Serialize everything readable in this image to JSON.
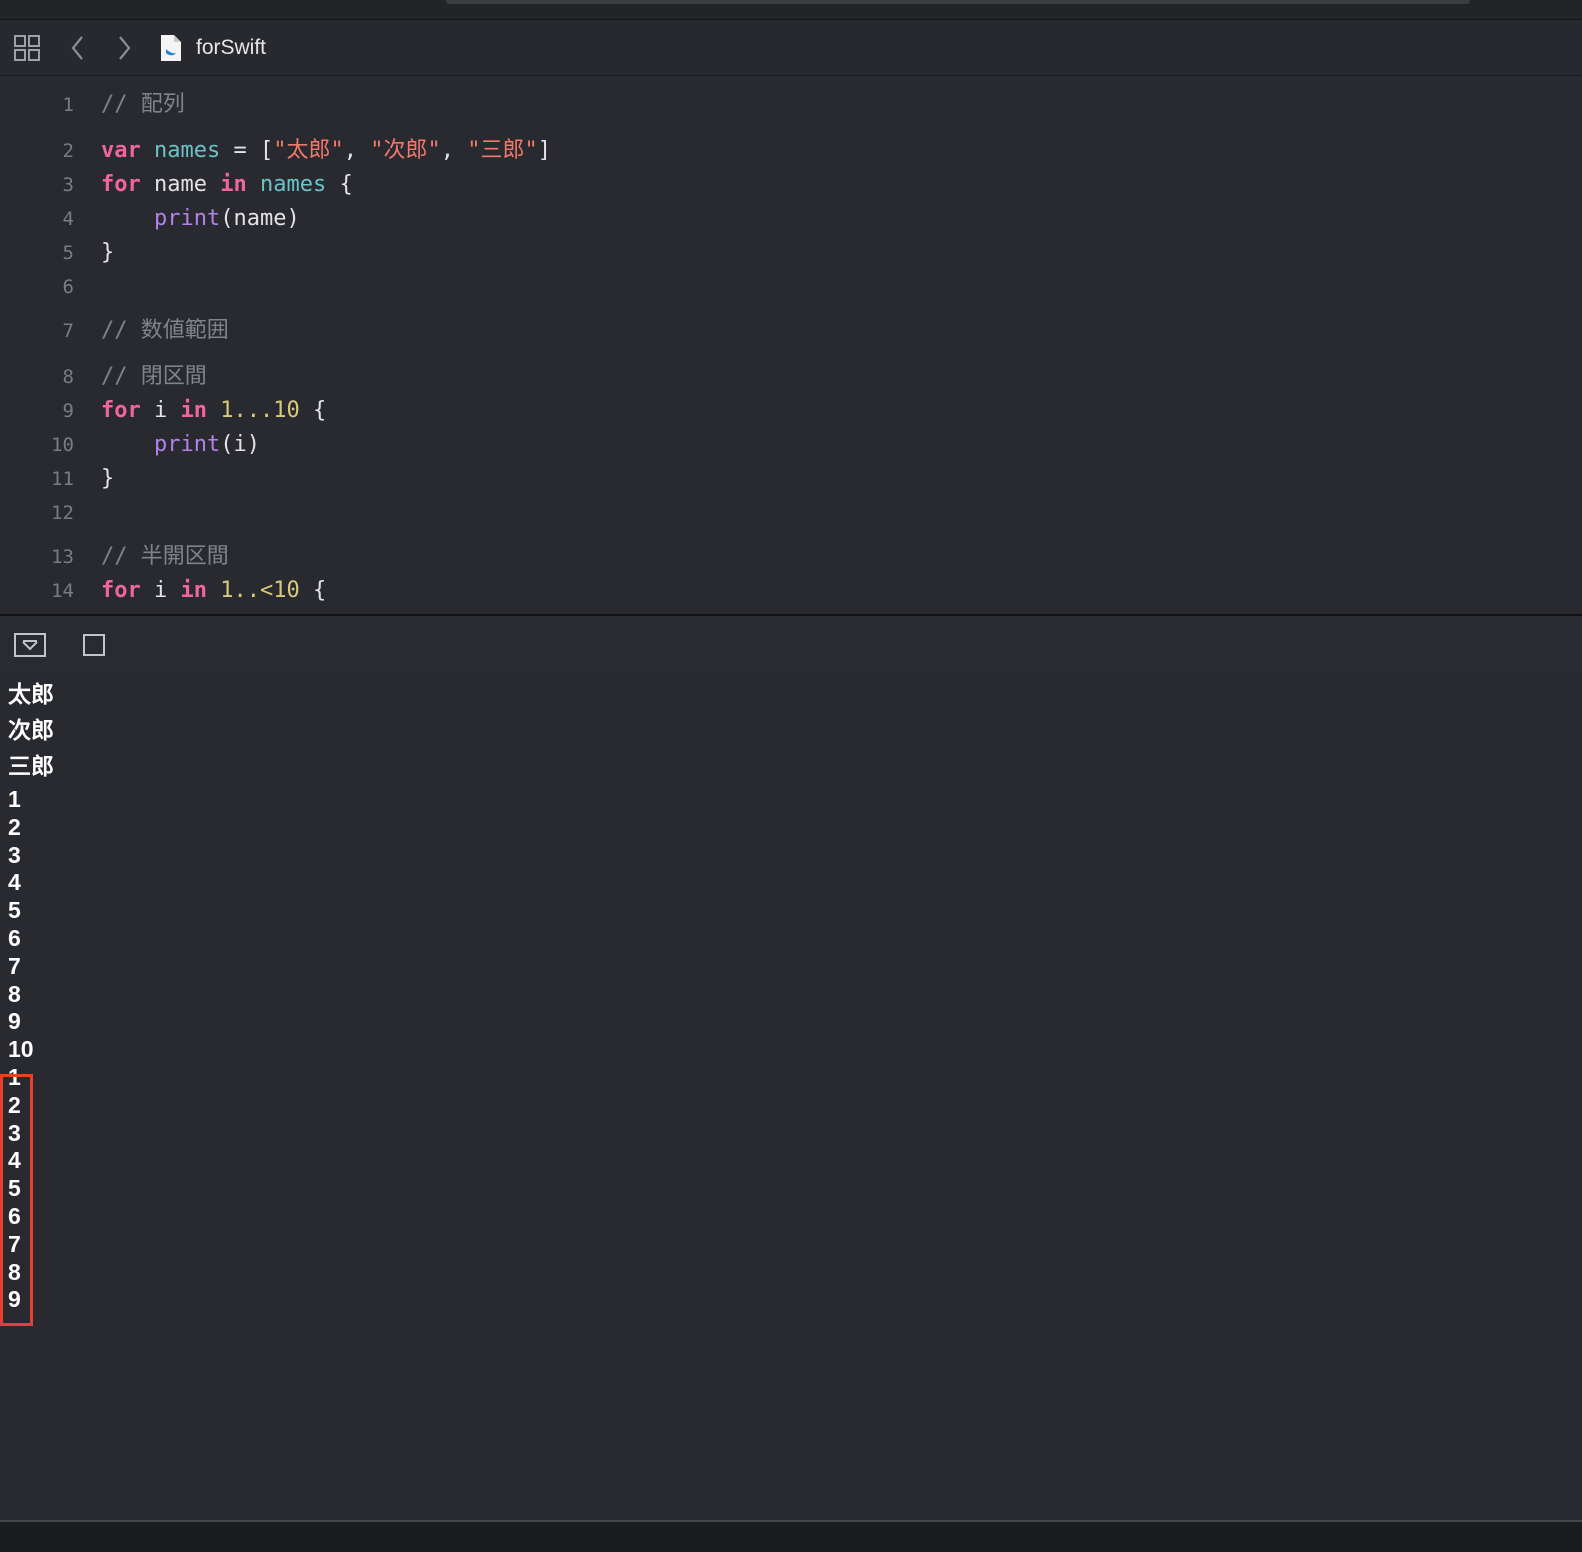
{
  "jumpbar": {
    "file_title": "forSwift",
    "icons": [
      "grid-icon",
      "back-arrow-icon",
      "forward-arrow-icon",
      "swift-file-icon"
    ]
  },
  "editor": {
    "lines": [
      {
        "n": "1",
        "tokens": [
          [
            "cm",
            "// 配列"
          ]
        ]
      },
      {
        "n": "2",
        "tokens": [
          [
            "kw",
            "var"
          ],
          [
            "plain",
            " "
          ],
          [
            "ident",
            "names"
          ],
          [
            "plain",
            " = ["
          ],
          [
            "str",
            "\"太郎\""
          ],
          [
            "plain",
            ", "
          ],
          [
            "str",
            "\"次郎\""
          ],
          [
            "plain",
            ", "
          ],
          [
            "str",
            "\"三郎\""
          ],
          [
            "plain",
            "]"
          ]
        ]
      },
      {
        "n": "3",
        "tokens": [
          [
            "kw",
            "for"
          ],
          [
            "plain",
            " name "
          ],
          [
            "kw",
            "in"
          ],
          [
            "plain",
            " "
          ],
          [
            "ident",
            "names"
          ],
          [
            "plain",
            " {"
          ]
        ]
      },
      {
        "n": "4",
        "tokens": [
          [
            "plain",
            "    "
          ],
          [
            "fn",
            "print"
          ],
          [
            "plain",
            "(name)"
          ]
        ]
      },
      {
        "n": "5",
        "tokens": [
          [
            "plain",
            "}"
          ]
        ]
      },
      {
        "n": "6",
        "tokens": []
      },
      {
        "n": "7",
        "tokens": [
          [
            "cm",
            "// 数値範囲"
          ]
        ]
      },
      {
        "n": "8",
        "tokens": [
          [
            "cm",
            "// 閉区間"
          ]
        ]
      },
      {
        "n": "9",
        "tokens": [
          [
            "kw",
            "for"
          ],
          [
            "plain",
            " i "
          ],
          [
            "kw",
            "in"
          ],
          [
            "plain",
            " "
          ],
          [
            "num",
            "1...10"
          ],
          [
            "plain",
            " {"
          ]
        ]
      },
      {
        "n": "10",
        "tokens": [
          [
            "plain",
            "    "
          ],
          [
            "fn",
            "print"
          ],
          [
            "plain",
            "(i)"
          ]
        ]
      },
      {
        "n": "11",
        "tokens": [
          [
            "plain",
            "}"
          ]
        ]
      },
      {
        "n": "12",
        "tokens": []
      },
      {
        "n": "13",
        "tokens": [
          [
            "cm",
            "// 半開区間"
          ]
        ]
      },
      {
        "n": "14",
        "tokens": [
          [
            "kw",
            "for"
          ],
          [
            "plain",
            " i "
          ],
          [
            "kw",
            "in"
          ],
          [
            "plain",
            " "
          ],
          [
            "num",
            "1..<10"
          ],
          [
            "plain",
            " {"
          ]
        ]
      }
    ]
  },
  "console_bar": {
    "icons": [
      "hide-debug-area-icon",
      "toggle-console-icon"
    ]
  },
  "console": {
    "output_names": [
      "太郎",
      "次郎",
      "三郎"
    ],
    "output_closed_range": [
      "1",
      "2",
      "3",
      "4",
      "5",
      "6",
      "7",
      "8",
      "9",
      "10"
    ],
    "output_half_open_range": [
      "1",
      "2",
      "3",
      "4",
      "5",
      "6",
      "7",
      "8",
      "9"
    ],
    "highlight_color": "#e8402d"
  }
}
